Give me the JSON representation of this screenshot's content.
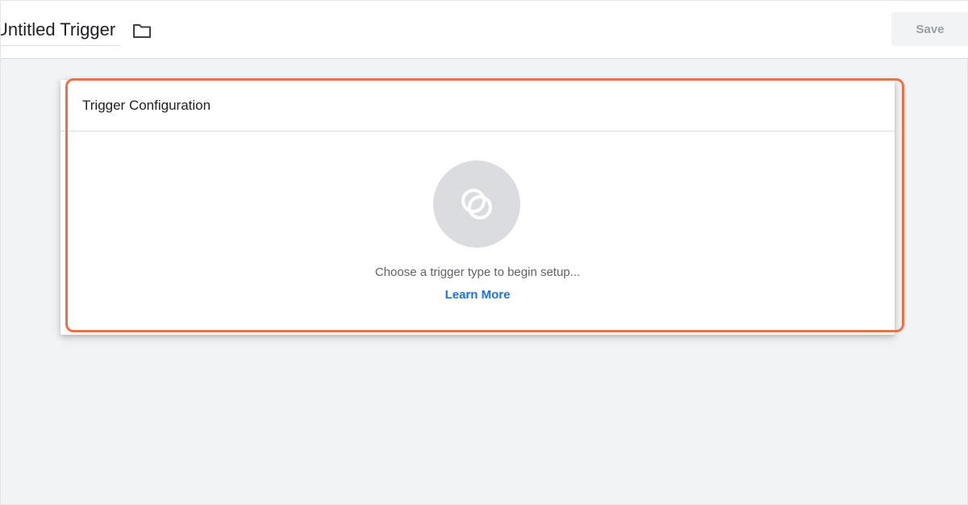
{
  "header": {
    "trigger_name": "Untitled Trigger",
    "save_label": "Save"
  },
  "card": {
    "title": "Trigger Configuration",
    "hint": "Choose a trigger type to begin setup...",
    "learn_more": "Learn More"
  },
  "icons": {
    "folder": "folder-icon",
    "trigger_type": "trigger-type-icon"
  },
  "colors": {
    "accent_link": "#1a73e8",
    "highlight": "#f07040",
    "page_bg": "#f1f3f4"
  }
}
